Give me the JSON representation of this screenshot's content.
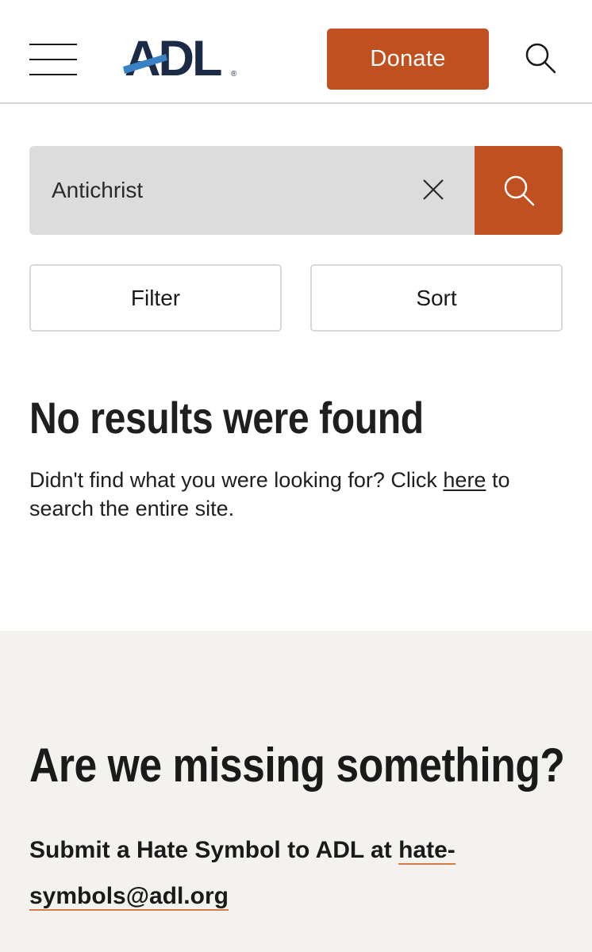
{
  "header": {
    "menu_icon": "hamburger-menu-icon",
    "logo_text": "ADL",
    "logo_mark": "®",
    "donate_label": "Donate",
    "search_icon": "search-icon"
  },
  "search": {
    "value": "Antichrist",
    "clear_icon": "close-icon",
    "submit_icon": "search-icon"
  },
  "controls": {
    "filter_label": "Filter",
    "sort_label": "Sort"
  },
  "results": {
    "title": "No results were found",
    "text_before": "Didn't find what you were looking for? Click ",
    "link_label": "here",
    "text_after": " to search the entire site."
  },
  "callout": {
    "title": "Are we missing something?",
    "text": "Submit a Hate Symbol to ADL at ",
    "email": "hate-symbols@adl.org"
  },
  "colors": {
    "accent": "#c0501f",
    "logo_navy": "#1b2a47",
    "logo_blue": "#3b82c4",
    "input_bg": "#dcdcdc",
    "callout_bg": "#f3f2ef",
    "link_underline": "#d97b49"
  }
}
